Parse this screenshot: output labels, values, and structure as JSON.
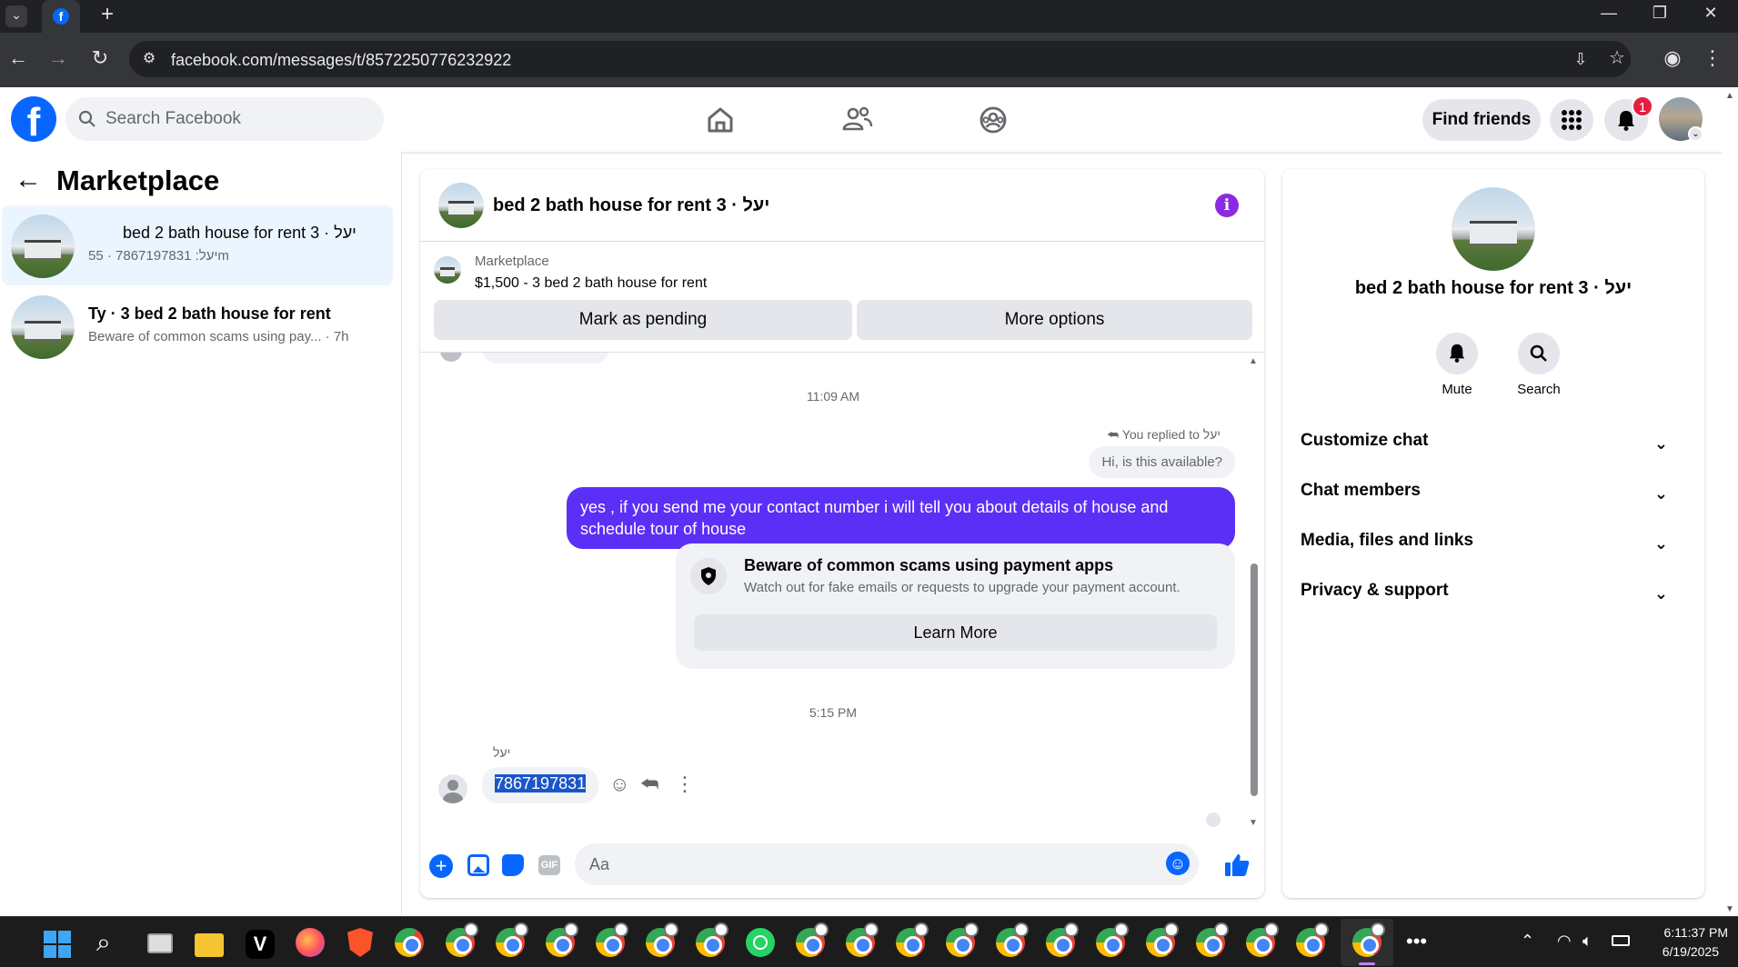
{
  "browser": {
    "url": "facebook.com/messages/t/8572250776232922",
    "window_controls": {
      "minimize": "—",
      "restore": "❐",
      "close": "✕"
    }
  },
  "header": {
    "search_placeholder": "Search Facebook",
    "find_friends": "Find friends",
    "notification_count": "1",
    "brand_color": "#0866ff"
  },
  "sidebar": {
    "title": "Marketplace",
    "conversations": [
      {
        "title": "bed 2 bath house for rent 3 · יעל",
        "subtitle": "יעל: 7867197831 · 55m",
        "active": true
      },
      {
        "title": "Ty · 3 bed 2 bath house for rent",
        "subtitle": "Beware of common scams using pay... · 7h",
        "active": false
      }
    ]
  },
  "chat": {
    "title": "bed 2 bath house for rent 3 · יעל",
    "listing_label": "Marketplace",
    "listing_price": "$1,500 - 3 bed 2 bath house for rent",
    "mark_pending": "Mark as pending",
    "more_options": "More options",
    "timestamp_1": "11:09 AM",
    "replied_to": "You replied to יעל",
    "quoted": "Hi, is this available?",
    "my_message": "yes , if you send me your contact number i will tell you about details of house and schedule tour of house",
    "scam_title": "Beware of common scams using payment apps",
    "scam_body": "Watch out for fake emails or requests to upgrade your payment account.",
    "learn_more": "Learn More",
    "timestamp_2": "5:15 PM",
    "sender_name": "יעל",
    "their_message": "7867197831",
    "composer_placeholder": "Aa",
    "accent_color": "#5b2ff5"
  },
  "info": {
    "name": "bed 2 bath house for rent 3 · יעל",
    "mute": "Mute",
    "search": "Search",
    "sections": [
      "Customize chat",
      "Chat members",
      "Media, files and links",
      "Privacy & support"
    ]
  },
  "taskbar": {
    "time": "6:11:37 PM",
    "date": "6/19/2025"
  }
}
